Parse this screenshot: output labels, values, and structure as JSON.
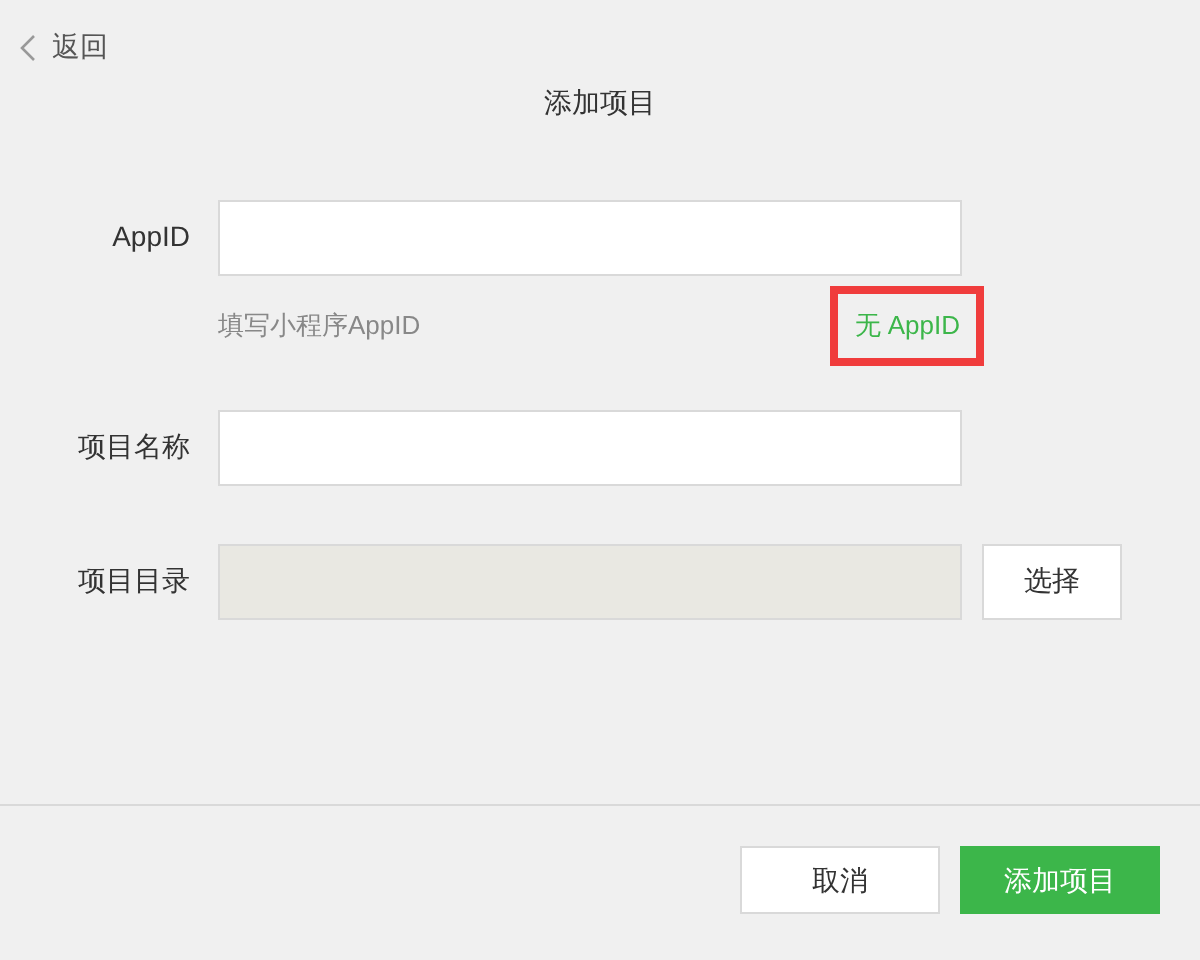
{
  "back": {
    "label": "返回"
  },
  "title": "添加项目",
  "fields": [
    {
      "label": "AppID",
      "disabled": false,
      "hint": "填写小程序AppID",
      "link": {
        "label": "无 AppID",
        "highlighted": true
      }
    },
    {
      "label": "项目名称",
      "disabled": false
    },
    {
      "label": "项目目录",
      "disabled": true,
      "button": "选择"
    }
  ],
  "buttons": [
    {
      "label": "取消",
      "kind": "secondary"
    },
    {
      "label": "添加项目",
      "kind": "primary"
    }
  ]
}
